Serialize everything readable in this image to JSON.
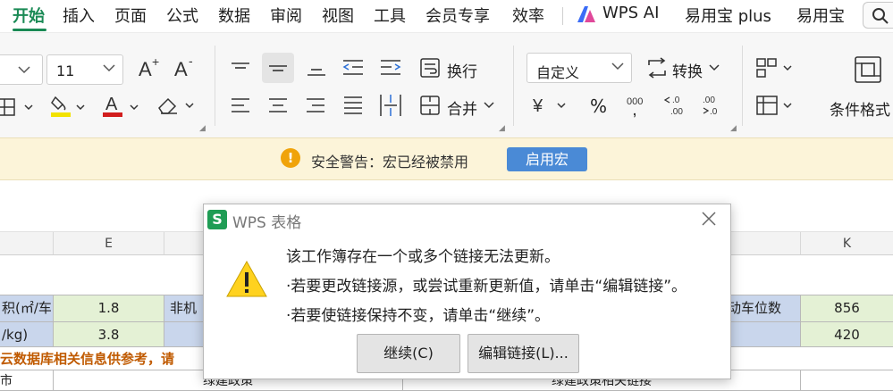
{
  "tabs": [
    {
      "label": "开始",
      "active": true
    },
    {
      "label": "插入"
    },
    {
      "label": "页面"
    },
    {
      "label": "公式"
    },
    {
      "label": "数据"
    },
    {
      "label": "审阅"
    },
    {
      "label": "视图"
    },
    {
      "label": "工具"
    },
    {
      "label": "会员专享"
    },
    {
      "label": "效率"
    },
    {
      "label": "WPS AI"
    },
    {
      "label": "易用宝 plus"
    },
    {
      "label": "易用宝"
    }
  ],
  "ribbon": {
    "font_size_value": "11",
    "wrap_label": "换行",
    "merge_label": "合并",
    "number_format_value": "自定义",
    "convert_label": "转换",
    "conditional_format_label": "条件格式",
    "percent_symbol": "%",
    "thousands_symbol": "000"
  },
  "security_bar": {
    "message": "安全警告：宏已经被禁用",
    "enable_button": "启用宏"
  },
  "sheet": {
    "col_headers": {
      "e": "E",
      "k": "K"
    },
    "rows": [
      {
        "a": "积(㎡/车)",
        "e": "1.8",
        "f": "非机",
        "j": "动车位数",
        "k": "856"
      },
      {
        "a": "/kg)",
        "e": "3.8",
        "k": "420"
      }
    ],
    "note_row": "云数据库相关信息供参考，请",
    "bottom_row": {
      "a": "市",
      "e_f": "绿建政策",
      "g_j": "绿建政策相关链接"
    }
  },
  "dialog": {
    "title": "WPS 表格",
    "icon_letter": "S",
    "lines": [
      "该工作簿存在一个或多个链接无法更新。",
      "·若要更改链接源，或尝试重新更新值，请单击“编辑链接”。",
      "·若要使链接保持不变，请单击“继续”。"
    ],
    "continue_button": "继续(C)",
    "edit_links_button": "编辑链接(L)..."
  },
  "colors": {
    "accent_green": "#1a8a55",
    "warning_orange": "#f0a30a",
    "enable_button_blue": "#4a8ad6",
    "cell_blue": "#c9d6ec",
    "cell_green": "#e4f1d5"
  }
}
